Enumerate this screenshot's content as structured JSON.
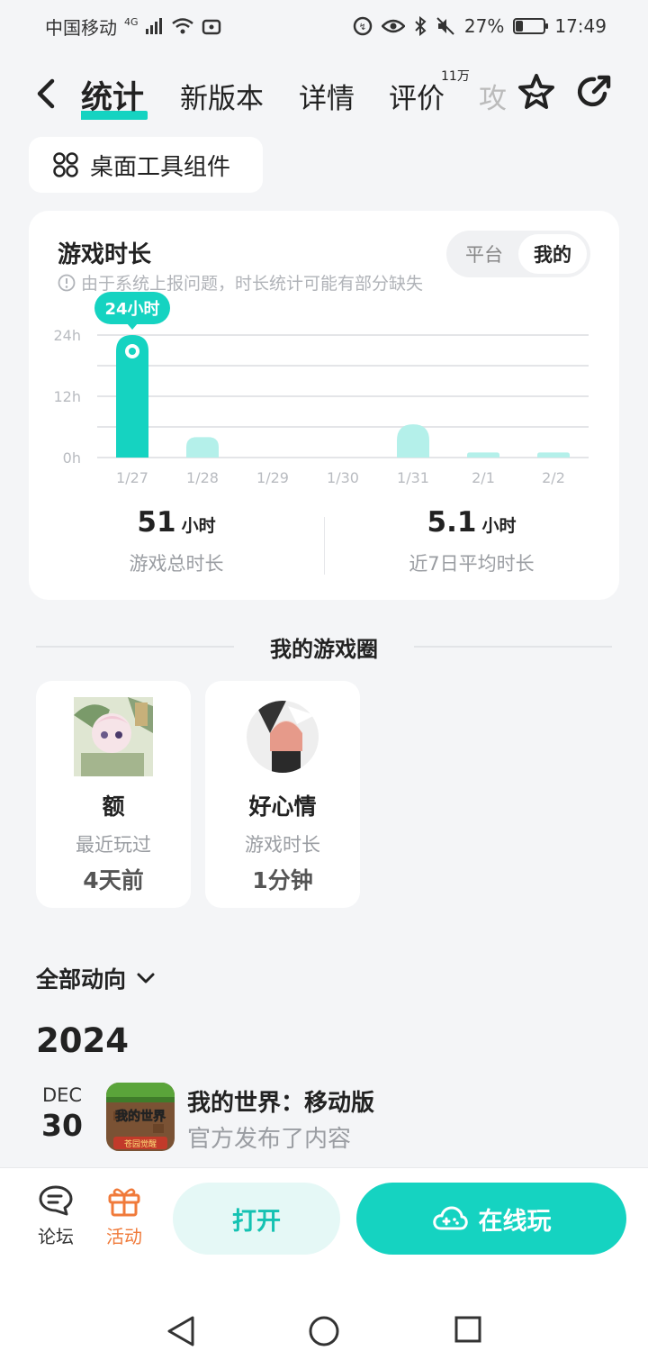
{
  "status_bar": {
    "carrier": "中国移动",
    "net_type": "4G",
    "battery": "27%",
    "battery_level": 0.27,
    "time": "17:49"
  },
  "header": {
    "tabs": [
      {
        "label": "统计",
        "active": true
      },
      {
        "label": "新版本",
        "active": false
      },
      {
        "label": "详情",
        "active": false
      },
      {
        "label": "评价",
        "active": false,
        "badge": "11万"
      },
      {
        "label": "攻",
        "active": false
      }
    ]
  },
  "widget_button": {
    "label": "桌面工具组件"
  },
  "stats_card": {
    "title": "游戏时长",
    "note": "由于系统上报问题，时长统计可能有部分缺失",
    "segment": {
      "options": [
        "平台",
        "我的"
      ],
      "selected": "我的"
    },
    "tooltip": "24小时",
    "total": {
      "value": "51",
      "unit": "小时",
      "label": "游戏总时长"
    },
    "average": {
      "value": "5.1",
      "unit": "小时",
      "label": "近7日平均时长"
    }
  },
  "chart_data": {
    "type": "bar",
    "categories": [
      "1/27",
      "1/28",
      "1/29",
      "1/30",
      "1/31",
      "2/1",
      "2/2"
    ],
    "values": [
      24,
      4,
      0,
      0,
      6.5,
      1,
      1
    ],
    "yticks": [
      "24h",
      "12h",
      "0h"
    ],
    "ylim": [
      0,
      24
    ],
    "highlight_index": 0,
    "colors": {
      "highlight": "#15d3c1",
      "normal": "#b4f0ea",
      "grid": "#e4e5e8",
      "tick": "#b8bbc0"
    }
  },
  "game_circle": {
    "title": "我的游戏圈",
    "cards": [
      {
        "name": "额",
        "sub": "最近玩过",
        "value": "4天前"
      },
      {
        "name": "好心情",
        "sub": "游戏时长",
        "value": "1分钟"
      }
    ]
  },
  "activity": {
    "filter": "全部动向",
    "year": "2024",
    "items": [
      {
        "month": "DEC",
        "day": "30",
        "icon_text": "我的世界",
        "icon_sub": "苍园觉醒",
        "title": "我的世界：移动版",
        "subtitle": "官方发布了内容"
      }
    ]
  },
  "bottom_bar": {
    "forum": "论坛",
    "activity": "活动",
    "open": "打开",
    "play_online": "在线玩",
    "colors": {
      "accent": "#15d3c1",
      "activity": "#f07a3a"
    }
  }
}
